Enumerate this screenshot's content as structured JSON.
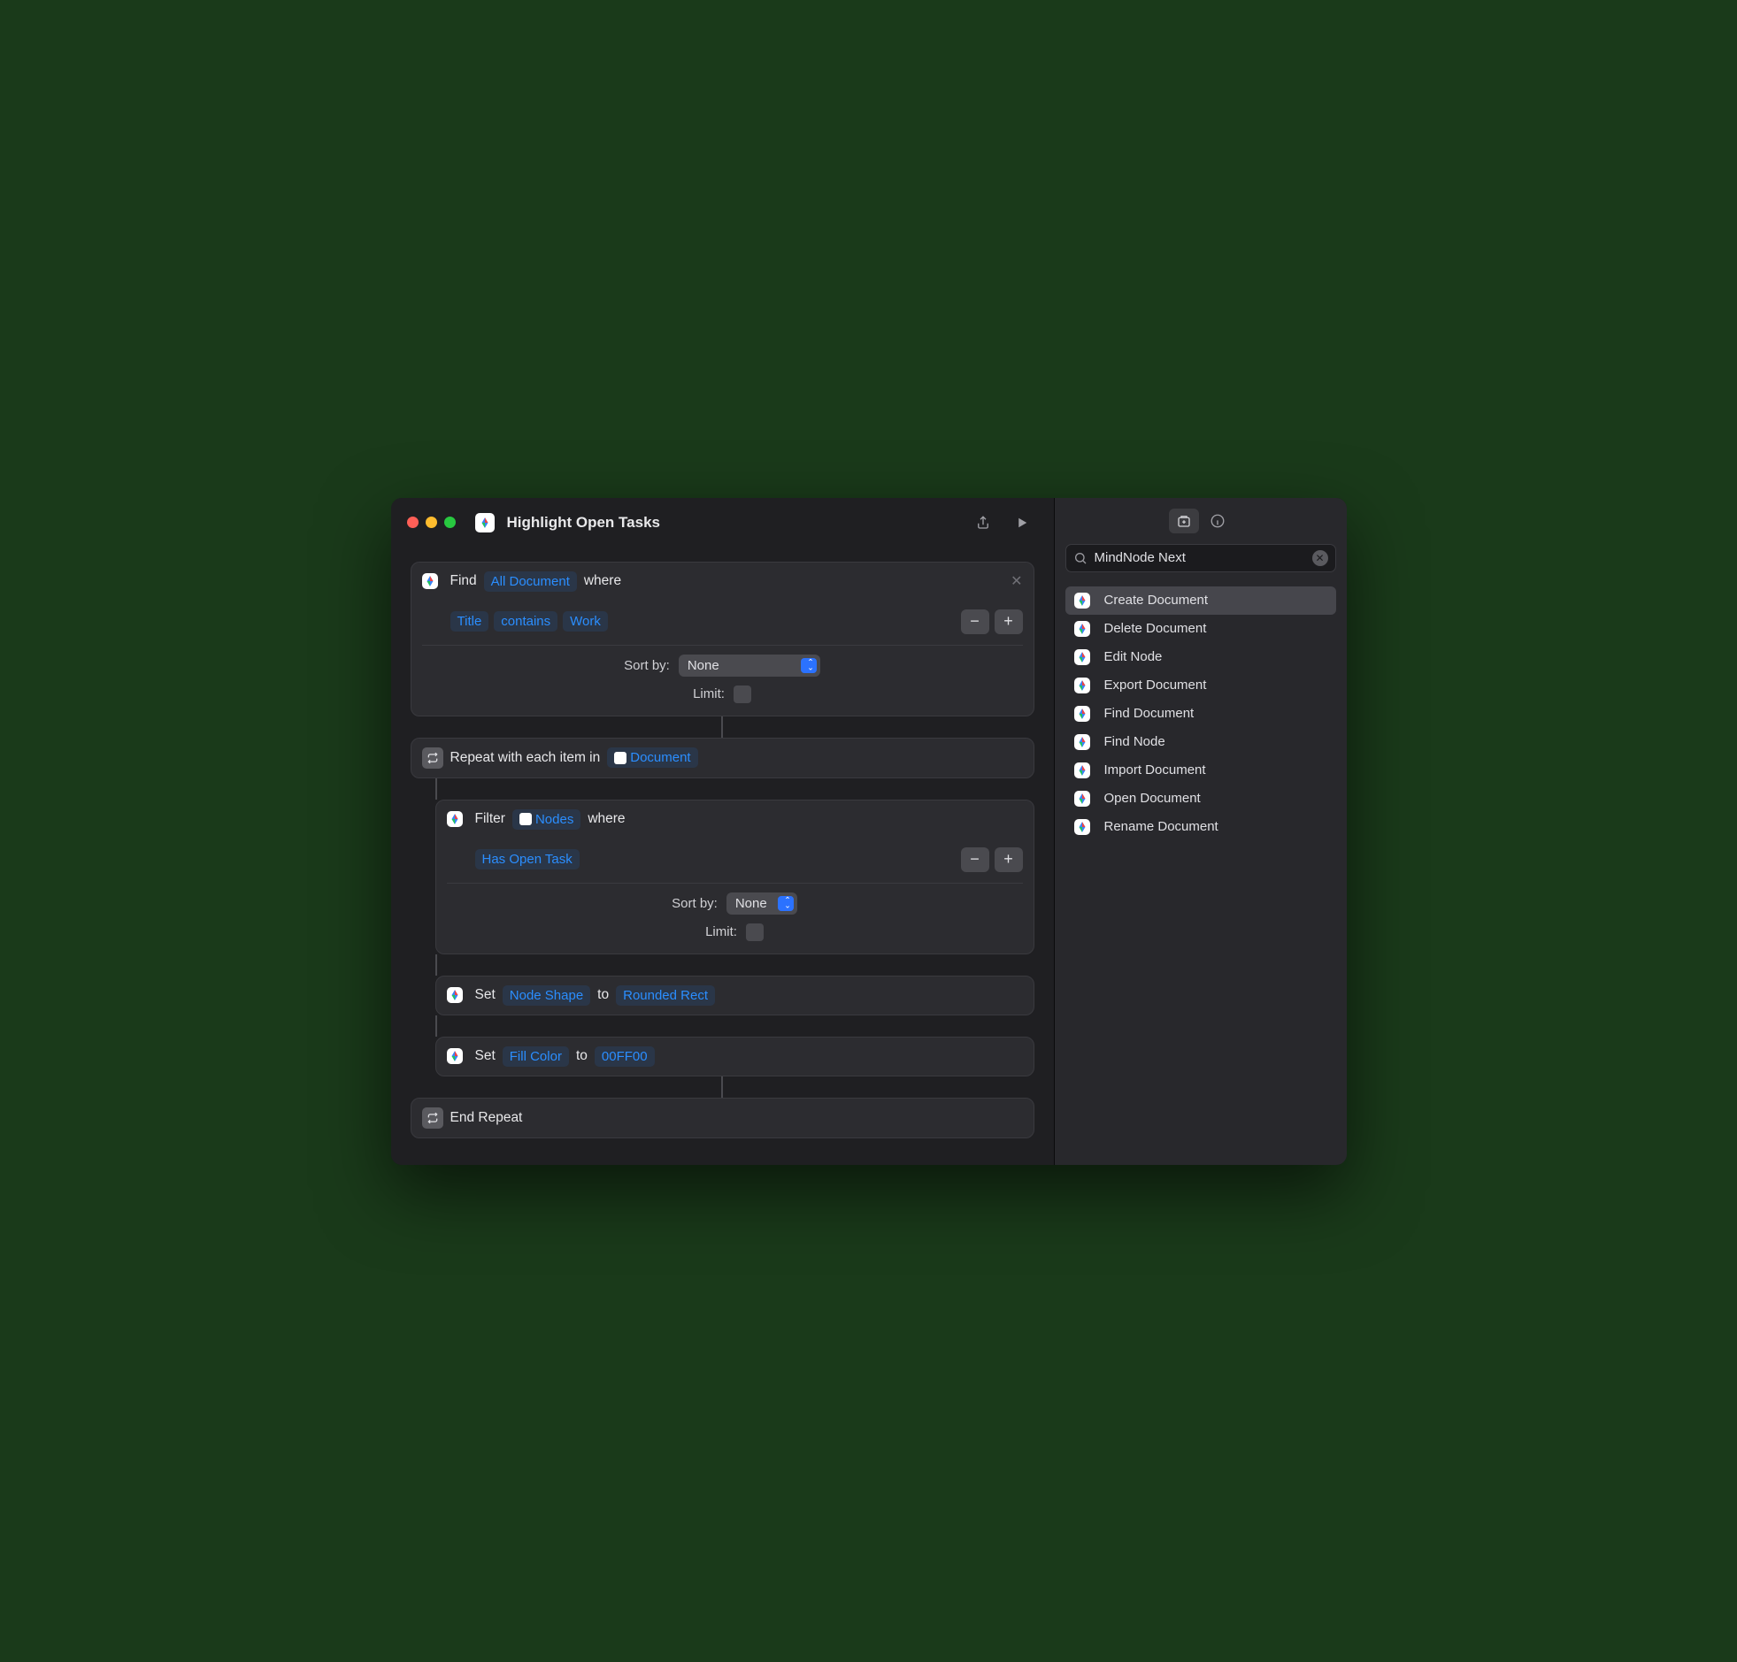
{
  "window": {
    "title": "Highlight Open Tasks"
  },
  "workflow": {
    "find": {
      "verb": "Find",
      "scope_token": "All Document",
      "where_label": "where",
      "filter": {
        "field": "Title",
        "op": "contains",
        "value": "Work"
      },
      "sort_label": "Sort by:",
      "sort_value": "None",
      "limit_label": "Limit:"
    },
    "repeat": {
      "label": "Repeat with each item in",
      "var_token": "Document",
      "end_label": "End Repeat",
      "steps": {
        "filter": {
          "verb": "Filter",
          "source_token": "Nodes",
          "where_label": "where",
          "condition": "Has Open Task",
          "sort_label": "Sort by:",
          "sort_value": "None",
          "limit_label": "Limit:"
        },
        "set_shape": {
          "verb": "Set",
          "field": "Node Shape",
          "to_label": "to",
          "value": "Rounded Rect"
        },
        "set_fill": {
          "verb": "Set",
          "field": "Fill Color",
          "to_label": "to",
          "value": "00FF00"
        }
      }
    }
  },
  "sidebar": {
    "search_value": "MindNode Next",
    "actions": [
      "Create Document",
      "Delete Document",
      "Edit Node",
      "Export Document",
      "Find Document",
      "Find Node",
      "Import Document",
      "Open Document",
      "Rename Document"
    ],
    "selected_index": 0
  }
}
